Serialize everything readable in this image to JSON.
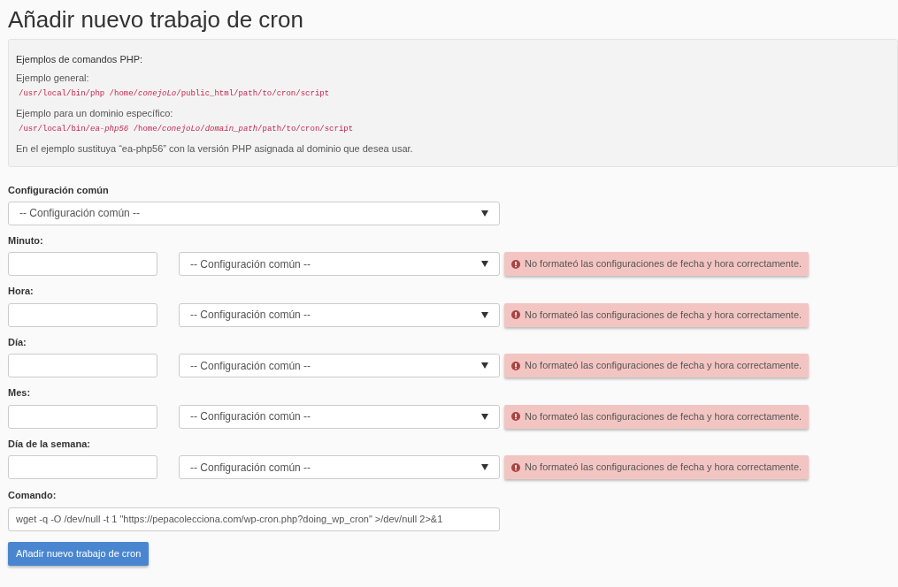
{
  "title": "Añadir nuevo trabajo de cron",
  "examples": {
    "heading": "Ejemplos de comandos PHP:",
    "items": [
      {
        "label": "Ejemplo general:",
        "code": "/usr/local/bin/php /home/*conejoLo*/public_html/path/to/cron/script"
      },
      {
        "label": "Ejemplo para un dominio específico:",
        "code": "/usr/local/bin/*ea-php56* /home/*conejoLo*/*domain_path*/path/to/cron/script"
      }
    ],
    "note": "En el ejemplo sustituya “ea-php56” con la versión PHP asignada al dominio que desea usar."
  },
  "common": {
    "label": "Configuración común",
    "value": "-- Configuración común --"
  },
  "fields": [
    {
      "label": "Minuto:",
      "select": "-- Configuración común --",
      "error": "No formateó las configuraciones de fecha y hora correctamente."
    },
    {
      "label": "Hora:",
      "select": "-- Configuración común --",
      "error": "No formateó las configuraciones de fecha y hora correctamente."
    },
    {
      "label": "Día:",
      "select": "-- Configuración común --",
      "error": "No formateó las configuraciones de fecha y hora correctamente."
    },
    {
      "label": "Mes:",
      "select": "-- Configuración común --",
      "error": "No formateó las configuraciones de fecha y hora correctamente."
    },
    {
      "label": "Día de la semana:",
      "select": "-- Configuración común --",
      "error": "No formateó las configuraciones de fecha y hora correctamente."
    }
  ],
  "command": {
    "label": "Comando:",
    "value": "wget -q -O /dev/null -t 1 \"https://pepacolecciona.com/wp-cron.php?doing_wp_cron\" >/dev/null 2>&1"
  },
  "submit": "Añadir nuevo trabajo de cron"
}
